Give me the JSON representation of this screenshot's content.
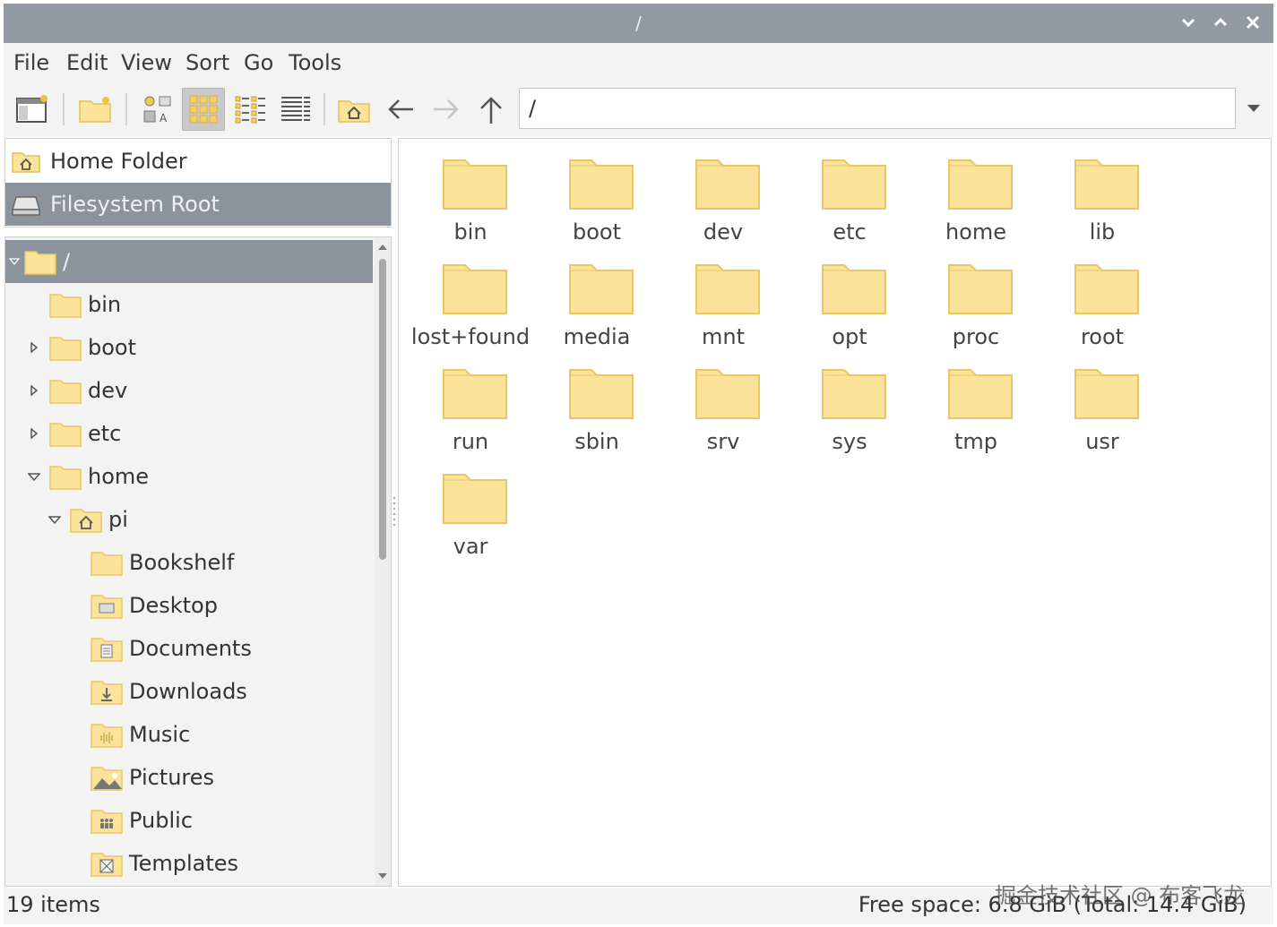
{
  "window": {
    "title": "/",
    "controls": [
      "minimize-icon",
      "maximize-icon",
      "close-icon"
    ]
  },
  "menu": [
    "File",
    "Edit",
    "View",
    "Sort",
    "Go",
    "Tools"
  ],
  "toolbar": {
    "buttons": [
      "new-window-icon",
      "new-folder-icon",
      "icon-view-icon",
      "thumbnail-view-icon",
      "compact-view-icon",
      "detailed-list-view-icon",
      "home-icon",
      "back-arrow-icon",
      "forward-arrow-icon",
      "up-arrow-icon"
    ],
    "path": "/"
  },
  "places": [
    {
      "label": "Home Folder",
      "icon": "home-folder-icon",
      "selected": false
    },
    {
      "label": "Filesystem Root",
      "icon": "drive-icon",
      "selected": true
    }
  ],
  "tree": [
    {
      "label": "/",
      "expander": "down",
      "selected": true
    },
    {
      "label": "bin",
      "expander": "none"
    },
    {
      "label": "boot",
      "expander": "right"
    },
    {
      "label": "dev",
      "expander": "right"
    },
    {
      "label": "etc",
      "expander": "right"
    },
    {
      "label": "home",
      "expander": "down"
    },
    {
      "label": "pi",
      "expander": "down"
    },
    {
      "label": "Bookshelf",
      "expander": "none"
    },
    {
      "label": "Desktop",
      "expander": "none"
    },
    {
      "label": "Documents",
      "expander": "none"
    },
    {
      "label": "Downloads",
      "expander": "none"
    },
    {
      "label": "Music",
      "expander": "none"
    },
    {
      "label": "Pictures",
      "expander": "none"
    },
    {
      "label": "Public",
      "expander": "none"
    },
    {
      "label": "Templates",
      "expander": "none"
    }
  ],
  "files": [
    "bin",
    "boot",
    "dev",
    "etc",
    "home",
    "lib",
    "lost+found",
    "media",
    "mnt",
    "opt",
    "proc",
    "root",
    "run",
    "sbin",
    "srv",
    "sys",
    "tmp",
    "usr",
    "var"
  ],
  "status": {
    "items": "19 items",
    "space": "Free space: 6.8 GiB (Total: 14.4 GiB)"
  },
  "watermark": "掘金技术社区 @ 布客飞龙",
  "colors": {
    "titlebar": "#929aa3",
    "selection": "#8b939c",
    "folder_fill": "#fbe39a",
    "folder_edge": "#e8c768"
  }
}
